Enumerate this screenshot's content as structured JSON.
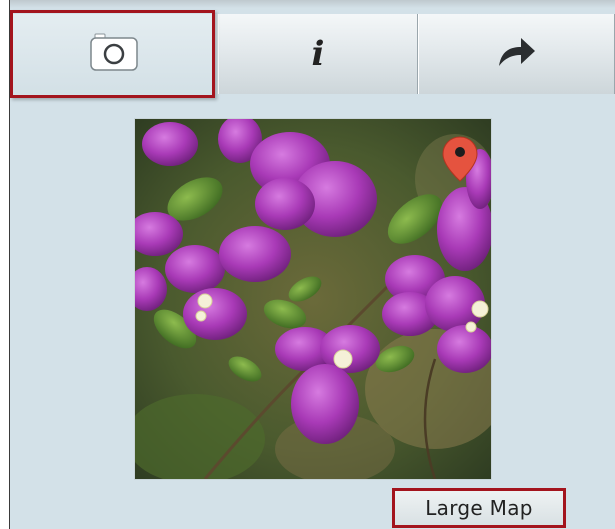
{
  "toolbar": {
    "tabs": [
      {
        "id": "photo",
        "icon": "camera-icon",
        "selected": true
      },
      {
        "id": "info",
        "icon": "info-icon",
        "glyph": "i"
      },
      {
        "id": "share",
        "icon": "share-arrow-icon"
      }
    ]
  },
  "photo": {
    "marker_icon": "map-pin-icon",
    "marker_color": "#e5533f"
  },
  "footer": {
    "large_map_label": "Large Map"
  },
  "colors": {
    "panel_background": "#d3e1e8",
    "highlight": "#a3141d"
  }
}
